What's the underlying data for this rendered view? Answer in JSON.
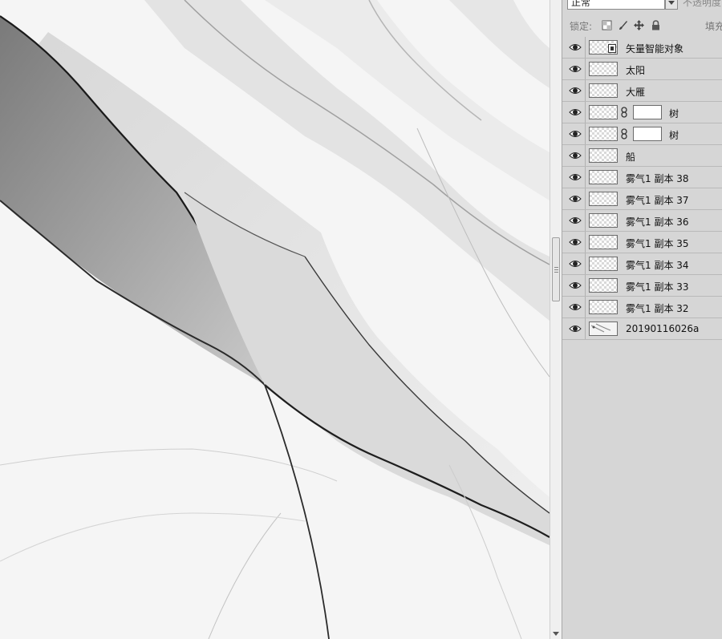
{
  "layers_panel": {
    "blend_mode": "正常",
    "opacity_label": "不透明度",
    "lock_label": "锁定:",
    "fill_label": "填充",
    "lock_icons": [
      "lock-transparent-icon",
      "lock-paint-icon",
      "lock-move-icon",
      "lock-all-icon"
    ],
    "layers": [
      {
        "name": "矢量智能对象",
        "thumb": "transparent",
        "smart_object": true,
        "mask": false,
        "visible": true
      },
      {
        "name": "太阳",
        "thumb": "transparent",
        "mask": false,
        "visible": true
      },
      {
        "name": "大雁",
        "thumb": "transparent",
        "mask": false,
        "visible": true
      },
      {
        "name": "树",
        "thumb": "transparent",
        "mask": true,
        "visible": true
      },
      {
        "name": "树",
        "thumb": "transparent",
        "mask": true,
        "visible": true
      },
      {
        "name": "船",
        "thumb": "transparent",
        "mask": false,
        "visible": true
      },
      {
        "name": "雾气1 副本 38",
        "thumb": "transparent",
        "mask": false,
        "visible": true
      },
      {
        "name": "雾气1 副本 37",
        "thumb": "transparent",
        "mask": false,
        "visible": true
      },
      {
        "name": "雾气1 副本 36",
        "thumb": "transparent",
        "mask": false,
        "visible": true
      },
      {
        "name": "雾气1 副本 35",
        "thumb": "transparent",
        "mask": false,
        "visible": true
      },
      {
        "name": "雾气1 副本 34",
        "thumb": "transparent",
        "mask": false,
        "visible": true
      },
      {
        "name": "雾气1 副本 33",
        "thumb": "transparent",
        "mask": false,
        "visible": true
      },
      {
        "name": "雾气1 副本 32",
        "thumb": "transparent",
        "mask": false,
        "visible": true
      },
      {
        "name": "20190116026a",
        "thumb": "photo",
        "mask": false,
        "visible": true
      }
    ]
  },
  "colors": {
    "panel_bg": "#d6d6d6",
    "canvas_bg": "#f4f4f4",
    "ink_dark": "#1a1a1a"
  }
}
